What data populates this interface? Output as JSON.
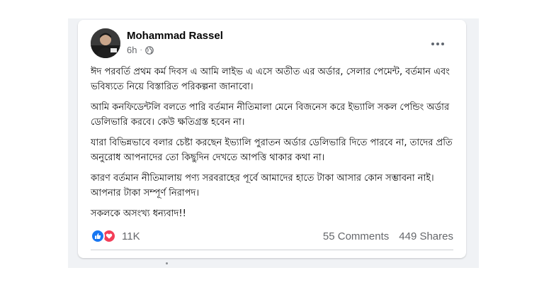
{
  "post": {
    "author": "Mohammad Rassel",
    "time": "6h",
    "visibility_icon": "globe-icon",
    "paragraphs": [
      "ঈদ পরবর্তি প্রথম কর্ম দিবস এ আমি লাইভ এ এসে অতীত এর অর্ডার, সেলার পেমেন্ট, বর্তমান এবং ভবিষ্যতে নিয়ে বিস্তারিত পরিকল্পনা জানাবো।",
      "আমি কনফিডেন্টলি বলতে পারি বর্তমান নীতিমালা মেনে বিজনেস করে ইভ্যালি সকল পেন্ডিং অর্ডার ডেলিভারি করবে। কেউ ক্ষতিগ্রস্ত হবেন না।",
      "যারা বিভিন্নভাবে বলার চেষ্টা করছেন ইভ্যালি পুরাতন অর্ডার ডেলিভারি দিতে পারবে না, তাদের প্রতি অনুরোধ আপনাদের তো কিছুদিন দেখতে আপত্তি থাকার কথা না।",
      "কারণ বর্তমান নীতিমালায়  পণ্য সরবরাহের পূর্বে আমাদের হাতে টাকা আসার কোন সম্ভাবনা নাই। আপনার টাকা সম্পূর্ণ নিরাপদ।",
      "সকলকে অসংখ্য ধন্যবাদ!!"
    ],
    "reactions": {
      "count": "11K",
      "icons": [
        "like-icon",
        "love-icon"
      ],
      "colors": {
        "like": "#1877f2",
        "love": "#f33e58"
      }
    },
    "comments": "55 Comments",
    "shares": "449 Shares"
  }
}
